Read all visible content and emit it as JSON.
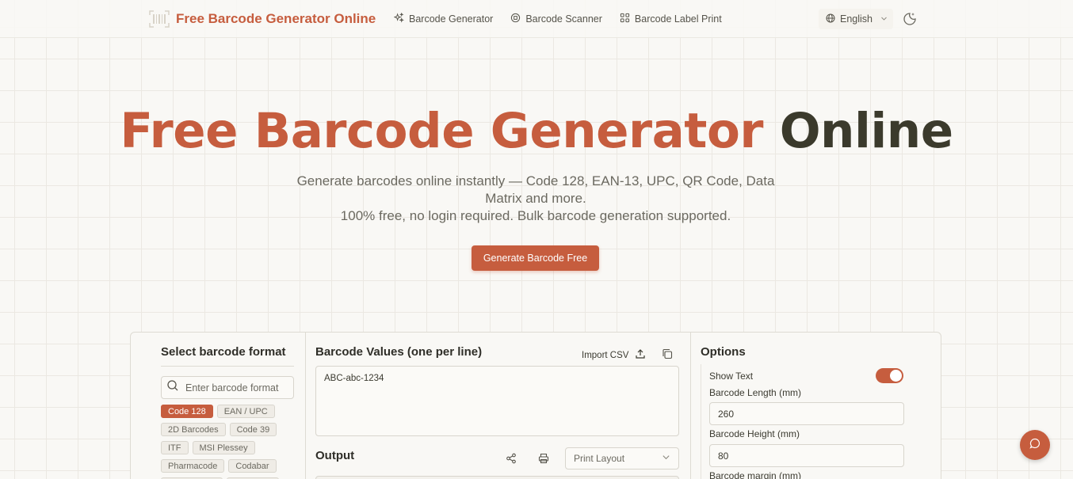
{
  "header": {
    "brand_title": "Free Barcode Generator Online",
    "nav": [
      {
        "label": "Barcode Generator",
        "icon": "sparkles-icon"
      },
      {
        "label": "Barcode Scanner",
        "icon": "scan-icon"
      },
      {
        "label": "Barcode Label Print",
        "icon": "grid-icon"
      }
    ],
    "language": "English",
    "theme_icon": "moon-sparkle-icon"
  },
  "hero": {
    "title_accent": "Free Barcode Generator",
    "title_rest": "Online",
    "subtitle_line1": "Generate barcodes online instantly — Code 128, EAN-13, UPC, QR Code, Data Matrix and more.",
    "subtitle_line2": "100% free, no login required. Bulk barcode generation supported.",
    "cta_label": "Generate Barcode Free"
  },
  "formats": {
    "title": "Select barcode format",
    "search_placeholder": "Enter barcode format",
    "chips": [
      {
        "label": "Code 128",
        "active": true
      },
      {
        "label": "EAN / UPC",
        "active": false
      },
      {
        "label": "2D Barcodes",
        "active": false
      },
      {
        "label": "Code 39",
        "active": false
      },
      {
        "label": "ITF",
        "active": false
      },
      {
        "label": "MSI Plessey",
        "active": false
      },
      {
        "label": "Pharmacode",
        "active": false
      },
      {
        "label": "Codabar",
        "active": false
      },
      {
        "label": "",
        "active": false
      },
      {
        "label": "",
        "active": false
      }
    ]
  },
  "values": {
    "title": "Barcode Values (one per line)",
    "import_csv_label": "Import CSV",
    "content": "ABC-abc-1234"
  },
  "output": {
    "title": "Output",
    "layout_select": "Print Layout"
  },
  "options": {
    "title": "Options",
    "show_text_label": "Show Text",
    "show_text": true,
    "length_label": "Barcode Length (mm)",
    "length_value": "260",
    "height_label": "Barcode Height (mm)",
    "height_value": "80",
    "margin_label": "Barcode margin (mm)"
  },
  "colors": {
    "accent": "#c65d3e",
    "dark_text": "#3b3a2c",
    "background": "#f9f8f5"
  }
}
